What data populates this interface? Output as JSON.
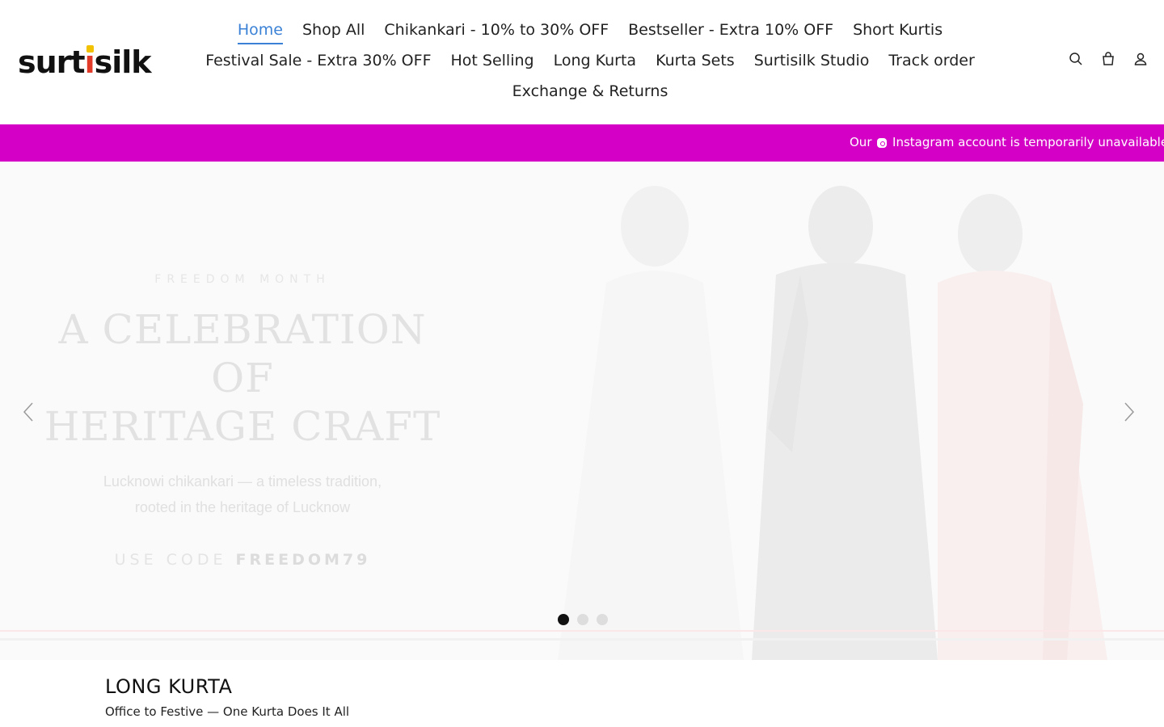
{
  "header": {
    "logo_text": "surtisilk",
    "nav_rows": [
      [
        "Home",
        "Shop All",
        "Chikankari - 10% to 30% OFF",
        "Bestseller - Extra 10% OFF",
        "Short Kurtis"
      ],
      [
        "Festival Sale - Extra 30% OFF",
        "Hot Selling",
        "Long Kurta",
        "Kurta Sets",
        "Surtisilk Studio",
        "Track order"
      ],
      [
        "Exchange & Returns"
      ]
    ],
    "active_nav": "Home",
    "icons": [
      "search-icon",
      "cart-icon",
      "account-icon"
    ]
  },
  "announcement": {
    "text_before": "Our",
    "text_after": "Instagram account is temporarily unavailable. Fo",
    "bg_color": "#d400c6"
  },
  "hero": {
    "eyebrow": "FREEDOM MONTH",
    "headline_line1": "A CELEBRATION OF",
    "headline_line2": "HERITAGE CRAFT",
    "sub_line1": "Lucknowi chikankari — a timeless tradition,",
    "sub_line2": "rooted in the heritage of Lucknow",
    "code_label": "USE CODE",
    "code_value": "FREEDOM79",
    "slides_count": 3,
    "active_slide": 1
  },
  "section": {
    "title": "LONG KURTA",
    "subtitle": "Office to Festive — One Kurta Does It All"
  },
  "colors": {
    "accent": "#3b82d6",
    "announcement": "#d400c6"
  }
}
